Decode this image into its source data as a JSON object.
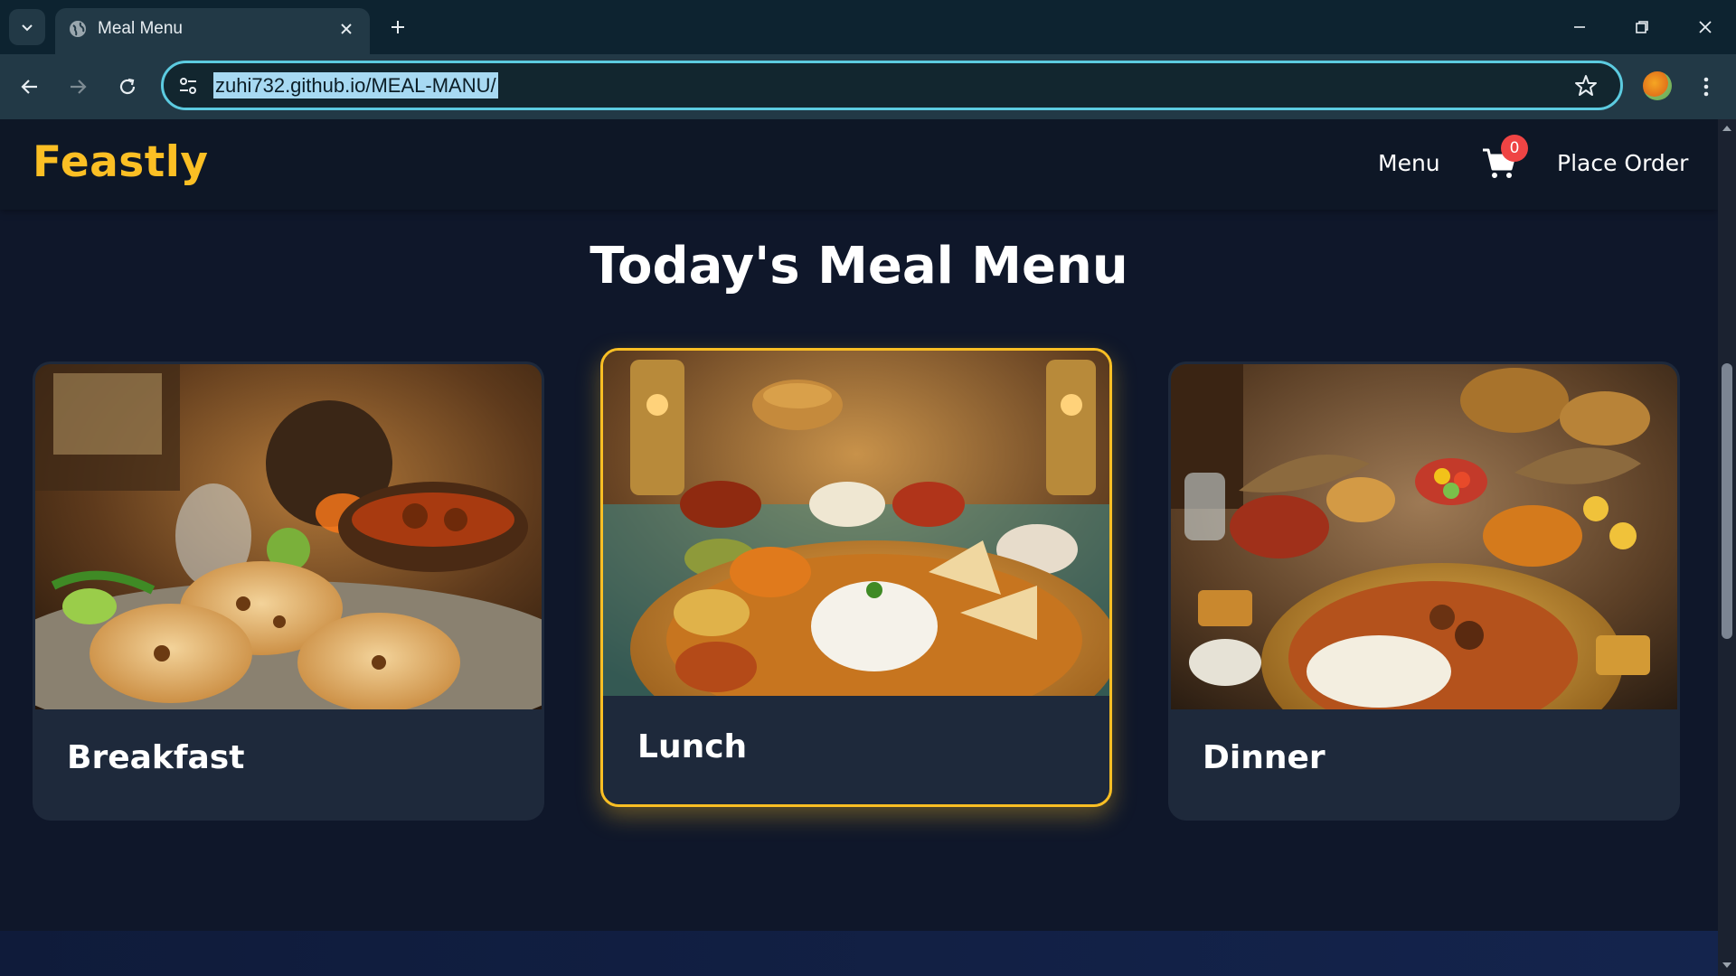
{
  "browser": {
    "tab_title": "Meal Menu",
    "url": "zuhi732.github.io/MEAL-MANU/"
  },
  "site": {
    "logo": "Feastly",
    "nav": {
      "menu": "Menu",
      "place_order": "Place Order"
    },
    "cart_count": "0",
    "page_title": "Today's Meal Menu"
  },
  "cards": [
    {
      "label": "Breakfast"
    },
    {
      "label": "Lunch"
    },
    {
      "label": "Dinner"
    }
  ],
  "colors": {
    "accent": "#fbbf24",
    "background": "#0f172a",
    "card": "#1e293b",
    "badge": "#ef4444",
    "omnibox_focus": "#5ccbe0"
  },
  "icons": [
    "tab-search-icon",
    "globe-icon",
    "close-icon",
    "plus-icon",
    "minimize-icon",
    "restore-icon",
    "window-close-icon",
    "back-arrow-icon",
    "forward-arrow-icon",
    "reload-icon",
    "site-info-icon",
    "star-icon",
    "profile-avatar",
    "kebab-menu-icon",
    "cart-icon"
  ]
}
